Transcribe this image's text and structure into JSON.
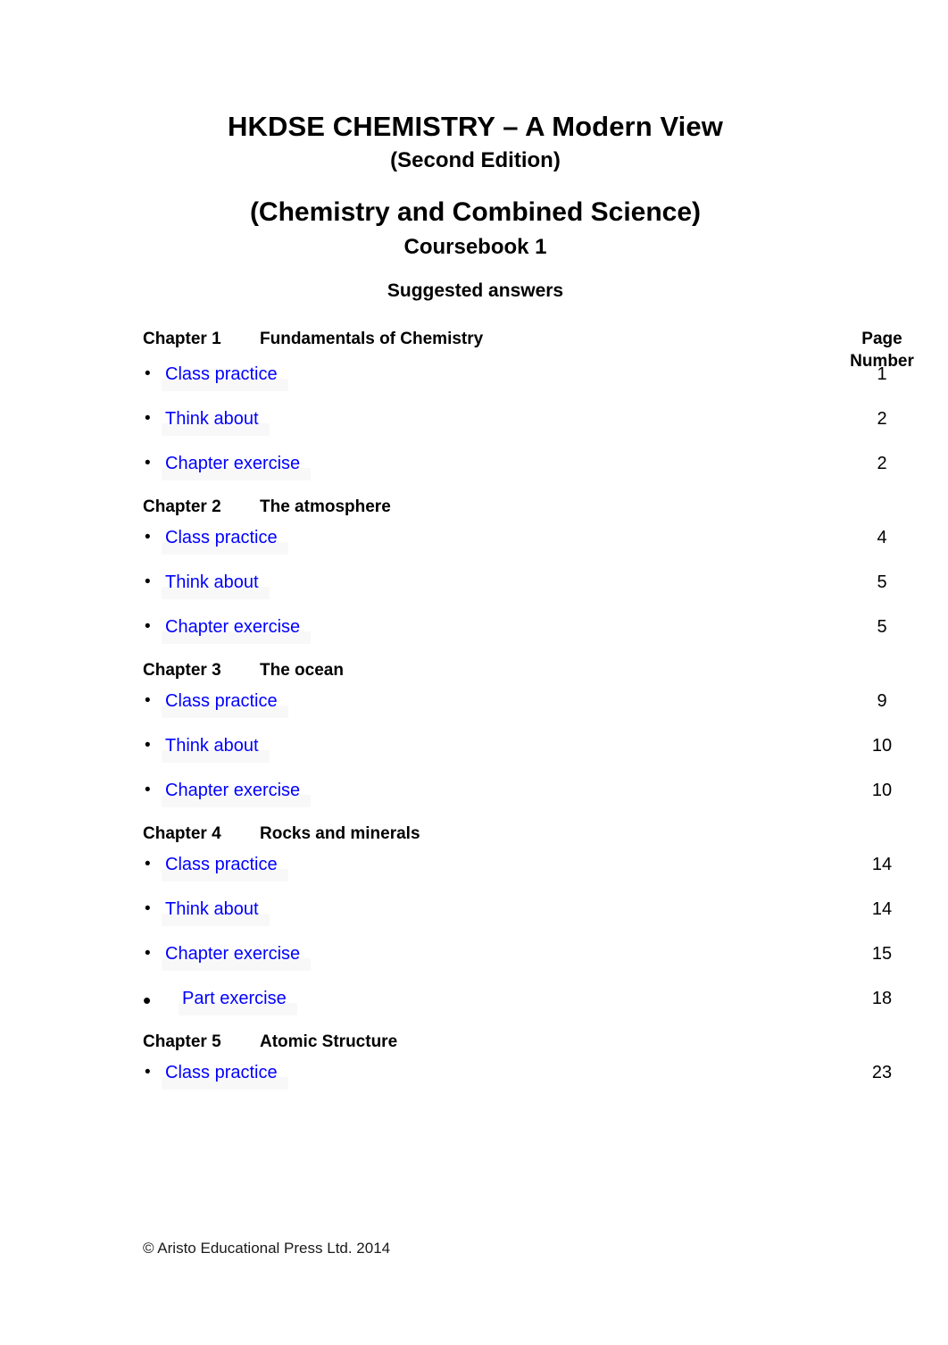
{
  "document": {
    "title_main": "HKDSE CHEMISTRY – A Modern View",
    "title_edition": "(Second Edition)",
    "title_subject": "(Chemistry and Combined Science)",
    "title_coursebook": "Coursebook 1",
    "title_suggested": "Suggested answers"
  },
  "columns": {
    "page_header_line1": "Page",
    "page_header_line2": "Number"
  },
  "chapters": [
    {
      "label": "Chapter 1",
      "title": "Fundamentals of Chemistry",
      "items": [
        {
          "bullet": "bullet-small",
          "text": "Class practice",
          "page": "1",
          "indent": false
        },
        {
          "bullet": "bullet-small",
          "text": "Think about",
          "page": "2",
          "indent": false
        },
        {
          "bullet": "bullet-small",
          "text": "Chapter exercise",
          "page": "2",
          "indent": false
        }
      ]
    },
    {
      "label": "Chapter 2",
      "title": "The atmosphere",
      "items": [
        {
          "bullet": "bullet-small",
          "text": "Class practice",
          "page": "4",
          "indent": false
        },
        {
          "bullet": "bullet-small",
          "text": "Think about",
          "page": "5",
          "indent": false
        },
        {
          "bullet": "bullet-small",
          "text": "Chapter exercise",
          "page": "5",
          "indent": false
        }
      ]
    },
    {
      "label": "Chapter 3",
      "title": "The ocean",
      "items": [
        {
          "bullet": "bullet-small",
          "text": "Class practice",
          "page": "9",
          "indent": false
        },
        {
          "bullet": "bullet-small",
          "text": "Think about",
          "page": "10",
          "indent": false
        },
        {
          "bullet": "bullet-small",
          "text": "Chapter exercise",
          "page": "10",
          "indent": false
        }
      ]
    },
    {
      "label": "Chapter 4",
      "title": "Rocks and minerals",
      "items": [
        {
          "bullet": "bullet-small",
          "text": "Class practice",
          "page": "14",
          "indent": false
        },
        {
          "bullet": "bullet-small",
          "text": "Think about",
          "page": "14",
          "indent": false
        },
        {
          "bullet": "bullet-small",
          "text": "Chapter exercise",
          "page": "15",
          "indent": false
        },
        {
          "bullet": "bullet-large",
          "text": "Part exercise",
          "page": "18",
          "indent": true
        }
      ]
    },
    {
      "label": "Chapter 5",
      "title": "Atomic Structure",
      "items": [
        {
          "bullet": "bullet-small",
          "text": "Class practice",
          "page": "23",
          "indent": false
        }
      ]
    }
  ],
  "footer": {
    "copyright": "© Aristo Educational Press Ltd. 2014"
  },
  "colors": {
    "link": "#0000ff",
    "text": "#000000",
    "background": "#ffffff"
  },
  "glyphs": {
    "bullet_small": "•",
    "bullet_large": "•"
  }
}
